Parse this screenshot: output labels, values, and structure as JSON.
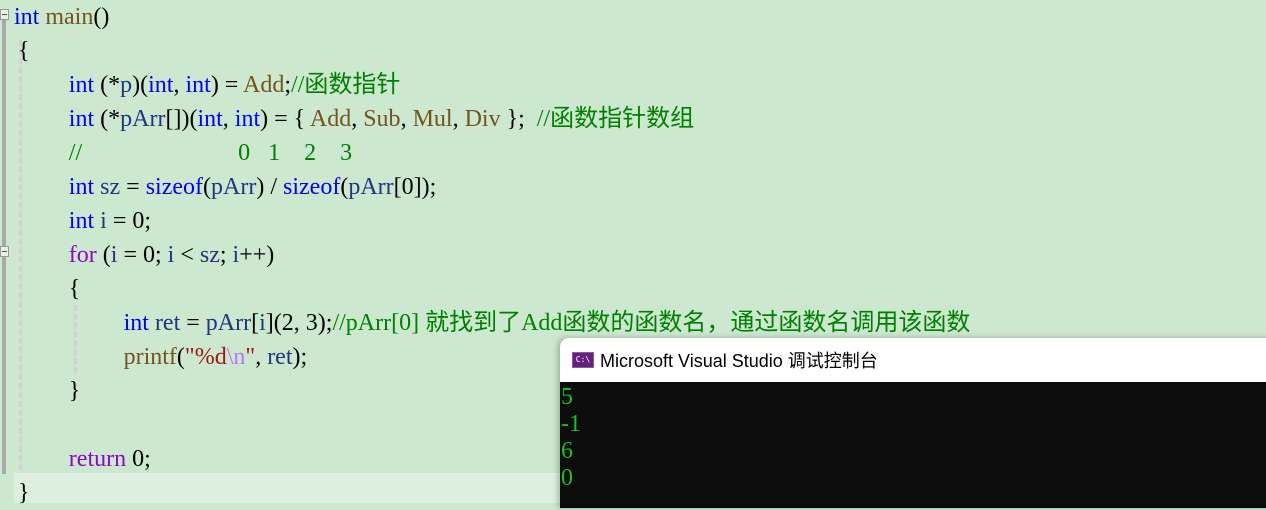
{
  "editor": {
    "lines": [
      {
        "tokens": [
          {
            "t": "int",
            "c": "kw"
          },
          {
            "t": " "
          },
          {
            "t": "main",
            "c": "fn"
          },
          {
            "t": "()",
            "c": "punct"
          }
        ]
      },
      {
        "tokens": [
          {
            "t": "{",
            "c": "punct"
          }
        ]
      },
      {
        "tokens": [
          {
            "t": "int",
            "c": "kw"
          },
          {
            "t": " (*",
            "c": "punct"
          },
          {
            "t": "p",
            "c": "var"
          },
          {
            "t": ")(",
            "c": "punct"
          },
          {
            "t": "int",
            "c": "kw"
          },
          {
            "t": ", ",
            "c": "punct"
          },
          {
            "t": "int",
            "c": "kw"
          },
          {
            "t": ") = ",
            "c": "punct"
          },
          {
            "t": "Add",
            "c": "fn"
          },
          {
            "t": ";",
            "c": "punct"
          },
          {
            "t": "//函数指针",
            "c": "cm"
          }
        ]
      },
      {
        "tokens": [
          {
            "t": "int",
            "c": "kw"
          },
          {
            "t": " (*",
            "c": "punct"
          },
          {
            "t": "pArr",
            "c": "var"
          },
          {
            "t": "[])(",
            "c": "punct"
          },
          {
            "t": "int",
            "c": "kw"
          },
          {
            "t": ", ",
            "c": "punct"
          },
          {
            "t": "int",
            "c": "kw"
          },
          {
            "t": ") = { ",
            "c": "punct"
          },
          {
            "t": "Add",
            "c": "fn"
          },
          {
            "t": ", ",
            "c": "punct"
          },
          {
            "t": "Sub",
            "c": "fn"
          },
          {
            "t": ", ",
            "c": "punct"
          },
          {
            "t": "Mul",
            "c": "fn"
          },
          {
            "t": ", ",
            "c": "punct"
          },
          {
            "t": "Div",
            "c": "fn"
          },
          {
            "t": " };  ",
            "c": "punct"
          },
          {
            "t": "//函数指针数组",
            "c": "cm"
          }
        ]
      },
      {
        "tokens": [
          {
            "t": "//                          0   1    2    3",
            "c": "cm"
          }
        ]
      },
      {
        "tokens": [
          {
            "t": "int",
            "c": "kw"
          },
          {
            "t": " "
          },
          {
            "t": "sz",
            "c": "var"
          },
          {
            "t": " = ",
            "c": "punct"
          },
          {
            "t": "sizeof",
            "c": "kw"
          },
          {
            "t": "(",
            "c": "punct"
          },
          {
            "t": "pArr",
            "c": "var"
          },
          {
            "t": ") / ",
            "c": "punct"
          },
          {
            "t": "sizeof",
            "c": "kw"
          },
          {
            "t": "(",
            "c": "punct"
          },
          {
            "t": "pArr",
            "c": "var"
          },
          {
            "t": "[0]);",
            "c": "punct"
          }
        ]
      },
      {
        "tokens": [
          {
            "t": "int",
            "c": "kw"
          },
          {
            "t": " "
          },
          {
            "t": "i",
            "c": "var"
          },
          {
            "t": " = 0;",
            "c": "punct"
          }
        ]
      },
      {
        "tokens": [
          {
            "t": "for",
            "c": "ctl"
          },
          {
            "t": " (",
            "c": "punct"
          },
          {
            "t": "i",
            "c": "var"
          },
          {
            "t": " = 0; ",
            "c": "punct"
          },
          {
            "t": "i",
            "c": "var"
          },
          {
            "t": " < ",
            "c": "punct"
          },
          {
            "t": "sz",
            "c": "var"
          },
          {
            "t": "; ",
            "c": "punct"
          },
          {
            "t": "i",
            "c": "var"
          },
          {
            "t": "++)",
            "c": "punct"
          }
        ]
      },
      {
        "tokens": [
          {
            "t": "{",
            "c": "punct"
          }
        ]
      },
      {
        "tokens": [
          {
            "t": "int",
            "c": "kw"
          },
          {
            "t": " "
          },
          {
            "t": "ret",
            "c": "var"
          },
          {
            "t": " = ",
            "c": "punct"
          },
          {
            "t": "pArr",
            "c": "var"
          },
          {
            "t": "[",
            "c": "punct"
          },
          {
            "t": "i",
            "c": "var"
          },
          {
            "t": "](2, 3);",
            "c": "punct"
          },
          {
            "t": "//pArr[0] 就找到了Add函数的函数名，通过函数名调用该函数",
            "c": "cm"
          }
        ]
      },
      {
        "tokens": [
          {
            "t": "printf",
            "c": "fn"
          },
          {
            "t": "(",
            "c": "punct"
          },
          {
            "t": "\"%d",
            "c": "str"
          },
          {
            "t": "\\n",
            "c": "esc"
          },
          {
            "t": "\"",
            "c": "str"
          },
          {
            "t": ", ",
            "c": "punct"
          },
          {
            "t": "ret",
            "c": "var"
          },
          {
            "t": ");",
            "c": "punct"
          }
        ]
      },
      {
        "tokens": [
          {
            "t": "}",
            "c": "punct"
          }
        ]
      },
      {
        "tokens": []
      },
      {
        "tokens": [
          {
            "t": "return",
            "c": "ctl"
          },
          {
            "t": " 0;",
            "c": "punct"
          }
        ]
      },
      {
        "tokens": [
          {
            "t": "}",
            "c": "punct"
          }
        ]
      }
    ]
  },
  "console": {
    "icon": "vs-console-icon",
    "icon_text": "C:\\",
    "title": "Microsoft Visual Studio 调试控制台",
    "output": [
      "5",
      "-1",
      "6",
      "0"
    ]
  }
}
